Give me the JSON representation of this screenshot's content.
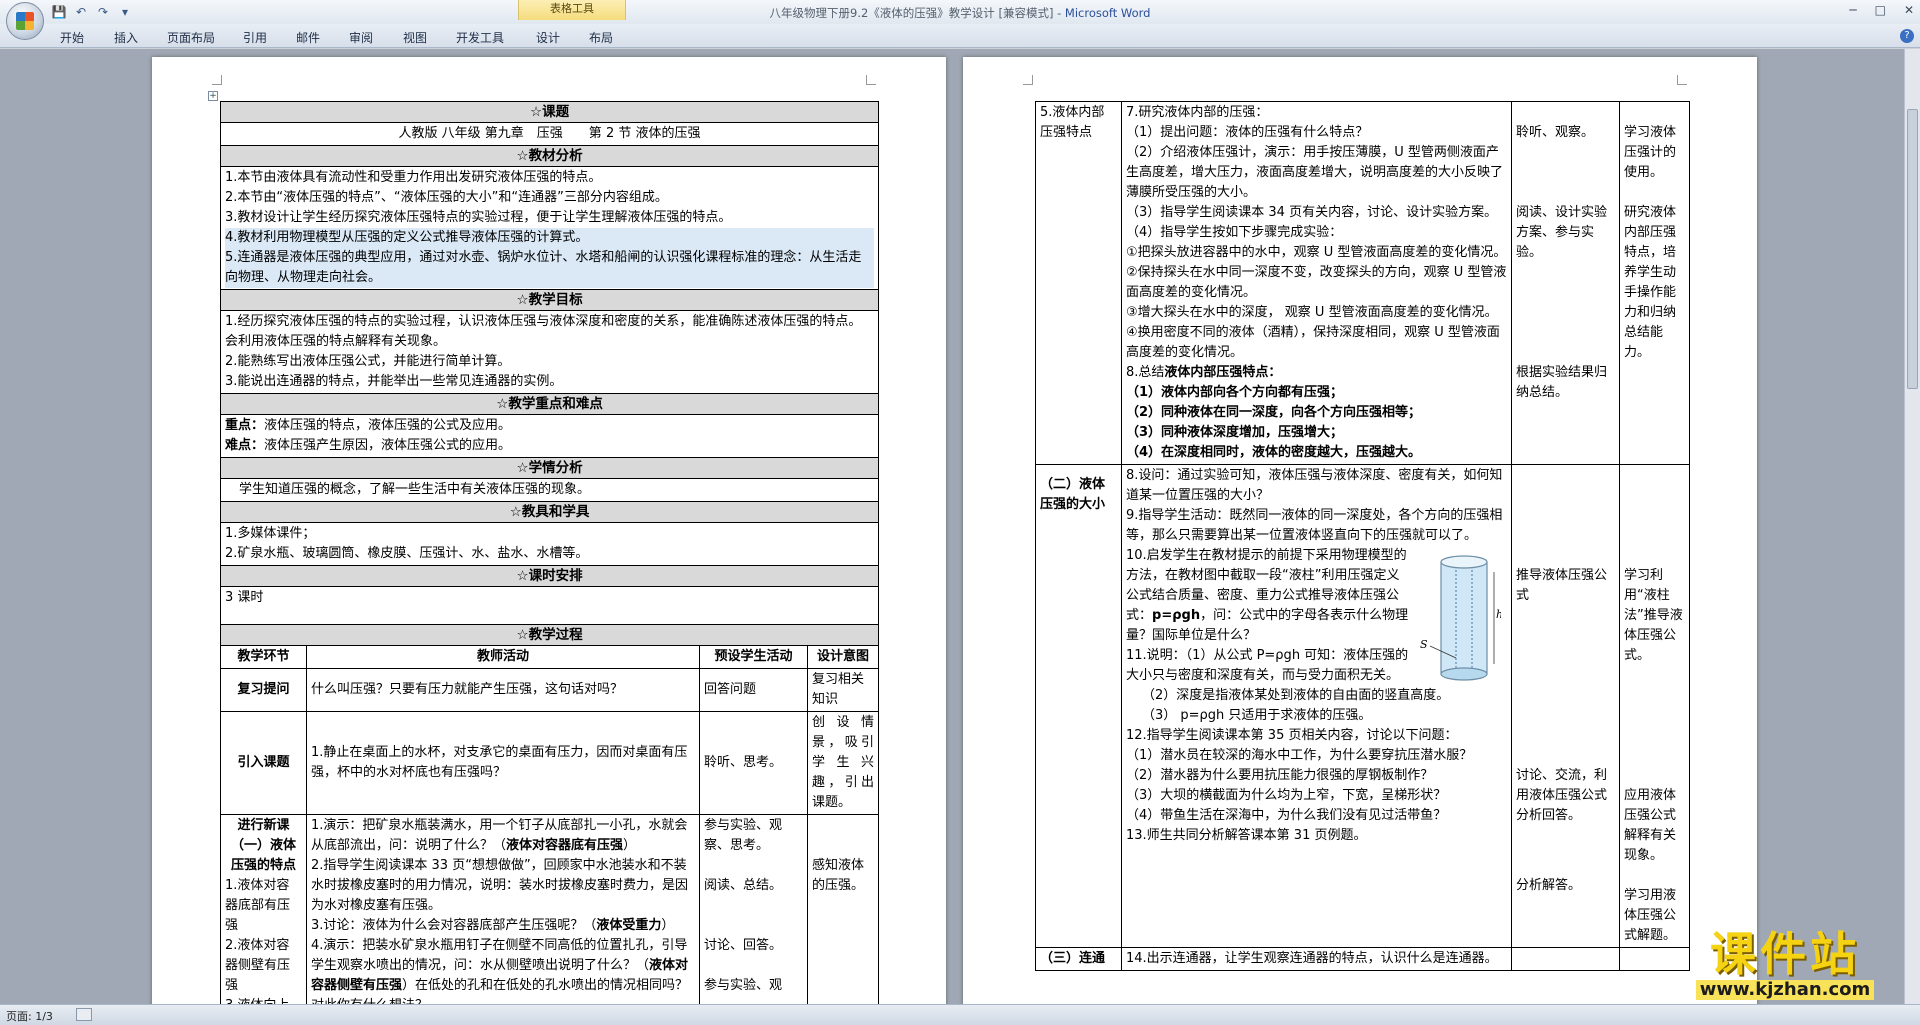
{
  "window": {
    "title": "八年级物理下册9.2《液体的压强》教学设计 [兼容模式] - ",
    "app": "Microsoft Word",
    "context_tools": "表格工具"
  },
  "qat": {
    "save": "💾",
    "undo": "↶",
    "redo": "↷",
    "more": "▾"
  },
  "winctrls": {
    "min": "─",
    "max": "□",
    "close": "✕"
  },
  "tabs": [
    "开始",
    "插入",
    "页面布局",
    "引用",
    "邮件",
    "审阅",
    "视图",
    "开发工具",
    "设计",
    "布局"
  ],
  "help": "?",
  "status": {
    "page": "页面: 1/3"
  },
  "watermark": {
    "main": "课件站",
    "url": "www.kjzhan.com"
  },
  "p1": {
    "h_topic": "☆课题",
    "topic": "人教版 八年级 第九章　压强　　第 2 节 液体的压强",
    "h_analysis": "☆教材分析",
    "analysis": [
      "1.本节由液体具有流动性和受重力作用出发研究液体压强的特点。",
      "2.本节由“液体压强的特点”、“液体压强的大小”和“连通器”三部分内容组成。",
      "3.教材设计让学生经历探究液体压强特点的实验过程，便于让学生理解液体压强的特点。",
      "4.教材利用物理模型从压强的定义公式推导液体压强的计算式。",
      "5.连通器是液体压强的典型应用，通过对水壶、锅炉水位计、水塔和船闸的认识强化课程标准的理念：从生活走向物理、从物理走向社会。"
    ],
    "h_goals": "☆教学目标",
    "goals": [
      "1.经历探究液体压强的特点的实验过程，认识液体压强与液体深度和密度的关系，能准确陈述液体压强的特点。会利用液体压强的特点解释有关现象。",
      "2.能熟练写出液体压强公式，并能进行简单计算。",
      "3.能说出连通器的特点，并能举出一些常见连通器的实例。"
    ],
    "h_key": "☆教学重点和难点",
    "key_label": "重点：",
    "key": "液体压强的特点，液体压强的公式及应用。",
    "diff_label": "难点：",
    "diff": "液体压强产生原因，液体压强公式的应用。",
    "h_student": "☆学情分析",
    "student": "学生知道压强的概念，了解一些生活中有关液体压强的现象。",
    "h_tools": "☆教具和学具",
    "tools": [
      "1.多媒体课件；",
      "2.矿泉水瓶、玻璃圆筒、橡皮膜、压强计、水、盐水、水槽等。"
    ],
    "h_time": "☆课时安排",
    "time": "3 课时",
    "h_process": "☆教学过程",
    "col": [
      "教学环节",
      "教师活动",
      "预设学生活动",
      "设计意图"
    ],
    "r1": {
      "stage": "复习提问",
      "teacher": "什么叫压强？只要有压力就能产生压强，这句话对吗？",
      "student": "回答问题",
      "purpose": "复习相关知识"
    },
    "r2": {
      "stage": "引入课题",
      "teacher": "1.静止在桌面上的水杯，对支承它的桌面有压力，因而对桌面有压强，杯中的水对杯底也有压强吗？",
      "student": "聆听、思考。",
      "purpose": "创设情景，吸引学生兴趣，引出课题。"
    },
    "r3": {
      "stage_title": "进行新课",
      "stage_sub": "（一）液体压强的特点",
      "stage_items": [
        "1.液体对容器底部有压强",
        "2.液体对容器侧壁有压强",
        "3.液体向上"
      ],
      "t1a": "1.演示：把矿泉水瓶装满水，用一个钉子从底部扎一小孔，水就会从底部流出，问：说明了什么？（",
      "t1b": "液体对容器底有压强",
      "t1c": "）",
      "t2": "2.指导学生阅读课本 33 页“想想做做”，回顾家中水池装水和不装水时拔橡皮塞时的用力情况，说明：装水时拔橡皮塞时费力，是因为水对橡皮塞有压强。",
      "t3a": "3.讨论：液体为什么会对容器底部产生压强呢？（",
      "t3b": "液体受重力",
      "t3c": "）",
      "t4a": "4.演示：把装水矿泉水瓶用钉子在侧壁不同高低的位置扎孔，引导学生观察水喷出的情况，问：水从侧壁喷出说明了什么？（",
      "t4b": "液体对容器侧壁有压强",
      "t4c": "）在低处的孔和在低处的孔水喷出的情况相同吗？对此你有什么想法？",
      "s": [
        "参与实验、观察、思考。",
        "阅读、总结。",
        "讨论、回答。",
        "参与实验、观"
      ],
      "p": "感知液体的压强。"
    }
  },
  "p2": {
    "r1": {
      "stage": "5.液体内部压强特点",
      "t7": "7.研究液体内部的压强：",
      "t7_1": "（1）提出问题：液体的压强有什么特点？",
      "t7_2": "（2）介绍液体压强计，演示：用手按压薄膜，U 型管两侧液面产生高度差，增大压力，液面高度差增大，说明高度差的大小反映了薄膜所受压强的大小。",
      "t7_3": "（3）指导学生阅读课本 34 页有关内容，讨论、设计实验方案。",
      "t7_4": "（4）指导学生按如下步骤完成实验：",
      "e1": "①把探头放进容器中的水中，观察 U 型管液面高度差的变化情况。",
      "e2": "②保持探头在水中同一深度不变，改变探头的方向，观察 U 型管液面高度差的变化情况。",
      "e3": "③增大探头在水中的深度， 观察 U 型管液面高度差的变化情况。",
      "e4": "④换用密度不同的液体（酒精），保持深度相同，观察 U 型管液面高度差的变化情况。",
      "t8": "8.总结",
      "t8b": "液体内部压强特点：",
      "c1": "（1）液体内部向各个方向都有压强；",
      "c2": "（2）同种液体在同一深度，向各个方向压强相等；",
      "c3": "（3）同种液体深度增加，压强增大；",
      "c4": "（4）在深度相同时，液体的密度越大，压强越大。",
      "s1": "聆听、观察。",
      "s2": "阅读、设计实验方案、参与实验。",
      "s3": "根据实验结果归纳总结。",
      "p1": "学习液体压强计的使用。",
      "p2": "研究液体内部压强特点，培养学生动手操作能力和归纳总结能力。"
    },
    "r2": {
      "stage": "（二）液体压强的大小",
      "t8": "8.设问：通过实验可知，液体压强与液体深度、密度有关，如何知道某一位置压强的大小？",
      "t9": "9.指导学生活动：既然同一液体的同一深度处，各个方向的压强相等，那么只需要算出某一位置液体竖直向下的压强就可以了。",
      "t10a": "10.启发学生在教材提示的前提下采用物理模型的方法，在教材图中截取一段“液柱”利用压强定义公式结合质量、密度、重力公式推导液体压强公式：",
      "t10b": "p=ρgh",
      "t10c": "，问：公式中的字母各表示什么物理量？国际单位是什么？",
      "t11": "11.说明：（1）从公式 P=ρgh 可知：液体压强的大小只与密度和深度有关，而与受力面积无关。",
      "t11_2": "（2）深度是指液体某处到液体的自由面的竖直高度。",
      "t11_3": "（3） p=ρgh 只适用于求液体的压强。",
      "t12": "12.指导学生阅读课本第 35 页相关内容，讨论以下问题：",
      "t12_1": "（1）潜水员在较深的海水中工作，为什么要穿抗压潜水服？",
      "t12_2": "（2）潜水器为什么要用抗压能力很强的厚钢板制作？",
      "t12_3": "（3）大坝的横截面为什么均为上窄，下宽，呈梯形状？",
      "t12_4": "（4）带鱼生活在深海中，为什么我们没有见过活带鱼？",
      "t13": "13.师生共同分析解答课本第 31 页例题。",
      "fig_h": "h",
      "fig_s": "S",
      "s1": "推导液体压强公式",
      "s2": "讨论、交流，利用液体压强公式分析回答。",
      "s3": "分析解答。",
      "p1": "学习利用“液柱法”推导液体压强公式。",
      "p2": "应用液体压强公式解释有关现象。",
      "p3": "学习用液体压强公式解题。"
    },
    "r3": {
      "stage": "（三）连通",
      "t14": "14.出示连通器，让学生观察连通器的特点，认识什么是连通器。"
    }
  }
}
